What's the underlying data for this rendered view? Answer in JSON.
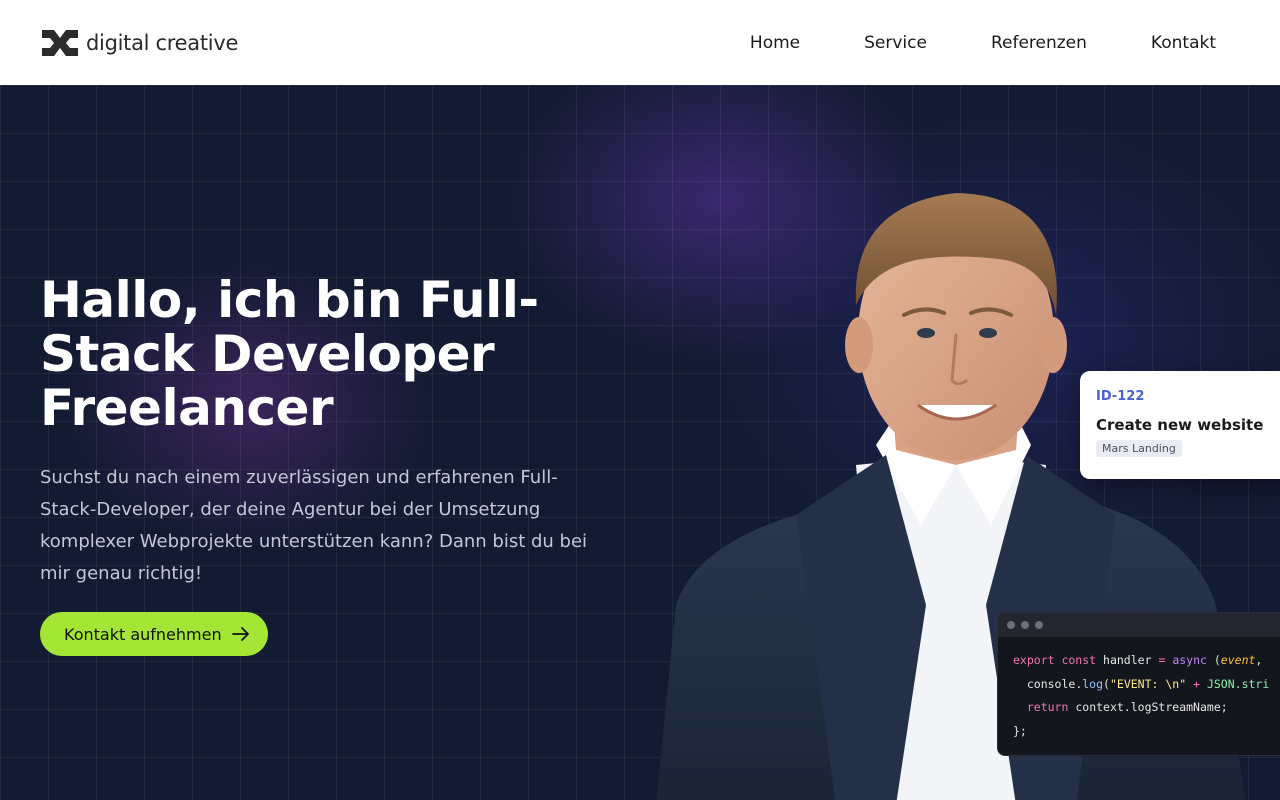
{
  "header": {
    "logo_text": "digital creative",
    "nav": [
      "Home",
      "Service",
      "Referenzen",
      "Kontakt"
    ]
  },
  "hero": {
    "title": "Hallo, ich bin Full-Stack Developer Freelancer",
    "text": "Suchst du nach einem zuverlässigen und erfahrenen Full-Stack-Developer, der deine Agentur bei der Umsetzung komplexer Webprojekte unterstützen kann? Dann bist du bei mir genau richtig!",
    "cta_label": "Kontakt aufnehmen"
  },
  "task_card": {
    "id": "ID-122",
    "title": "Create new website",
    "tag": "Mars Landing"
  },
  "code": {
    "line1_kw": "export const",
    "line1_name": "handler",
    "line1_eq": "=",
    "line1_async": "async",
    "line1_param": "event",
    "line2_obj": "console.",
    "line2_fn": "log",
    "line2_str": "\"EVENT: \\n\"",
    "line2_plus": "+",
    "line2_json": "JSON.stri",
    "line3_kw": "return",
    "line3_rest": "context.logStreamName;",
    "line4": "};"
  },
  "colors": {
    "accent": "#a3e635",
    "background": "#131b33",
    "task_id": "#4a5fd0"
  }
}
